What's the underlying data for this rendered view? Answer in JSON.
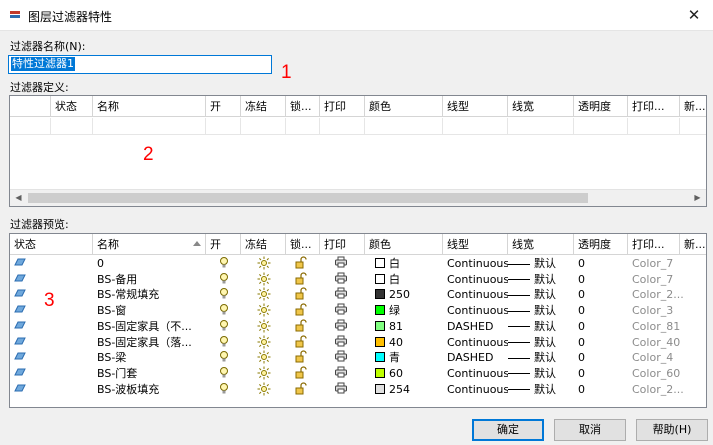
{
  "window": {
    "title": "图层过滤器特性",
    "close_glyph": "✕"
  },
  "filter_name": {
    "label": "过滤器名称(N):",
    "value": "特性过滤器1"
  },
  "definition_label": "过滤器定义:",
  "preview_label": "过滤器预览:",
  "markers": [
    "1",
    "2",
    "3"
  ],
  "definition_columns": [
    "状态",
    "名称",
    "开",
    "冻结",
    "锁...",
    "打印",
    "颜色",
    "线型",
    "线宽",
    "透明度",
    "打印...",
    "新..."
  ],
  "preview_columns": [
    "状态",
    "名称",
    "开",
    "冻结",
    "锁...",
    "打印",
    "颜色",
    "线型",
    "线宽",
    "透明度",
    "打印...",
    "新..."
  ],
  "layers": [
    {
      "name": "0",
      "color_name": "白",
      "color_hex": "#ffffff",
      "linetype": "Continuous",
      "lineweight": "默认",
      "transparency": "0",
      "plot_style": "Color_7"
    },
    {
      "name": "BS-备用",
      "color_name": "白",
      "color_hex": "#ffffff",
      "linetype": "Continuous",
      "lineweight": "默认",
      "transparency": "0",
      "plot_style": "Color_7"
    },
    {
      "name": "BS-常规填充",
      "color_name": "250",
      "color_hex": "#333333",
      "linetype": "Continuous",
      "lineweight": "默认",
      "transparency": "0",
      "plot_style": "Color_2..."
    },
    {
      "name": "BS-窗",
      "color_name": "绿",
      "color_hex": "#00ff00",
      "linetype": "Continuous",
      "lineweight": "默认",
      "transparency": "0",
      "plot_style": "Color_3"
    },
    {
      "name": "BS-固定家具（不...",
      "color_name": "81",
      "color_hex": "#80ff80",
      "linetype": "DASHED",
      "lineweight": "默认",
      "transparency": "0",
      "plot_style": "Color_81"
    },
    {
      "name": "BS-固定家具（落...",
      "color_name": "40",
      "color_hex": "#ffbf00",
      "linetype": "Continuous",
      "lineweight": "默认",
      "transparency": "0",
      "plot_style": "Color_40"
    },
    {
      "name": "BS-梁",
      "color_name": "青",
      "color_hex": "#00ffff",
      "linetype": "DASHED",
      "lineweight": "默认",
      "transparency": "0",
      "plot_style": "Color_4"
    },
    {
      "name": "BS-门套",
      "color_name": "60",
      "color_hex": "#bfff00",
      "linetype": "Continuous",
      "lineweight": "默认",
      "transparency": "0",
      "plot_style": "Color_60"
    },
    {
      "name": "BS-波板填充",
      "color_name": "254",
      "color_hex": "#e0e0e0",
      "linetype": "Continuous",
      "lineweight": "默认",
      "transparency": "0",
      "plot_style": "Color_2..."
    }
  ],
  "icons": {
    "status": "layer-status-icon",
    "on": "lightbulb-icon",
    "freeze": "sun-icon",
    "lock": "padlock-open-icon",
    "plot": "printer-icon"
  },
  "buttons": {
    "ok": "确定",
    "cancel": "取消",
    "help": "帮助(H)"
  }
}
